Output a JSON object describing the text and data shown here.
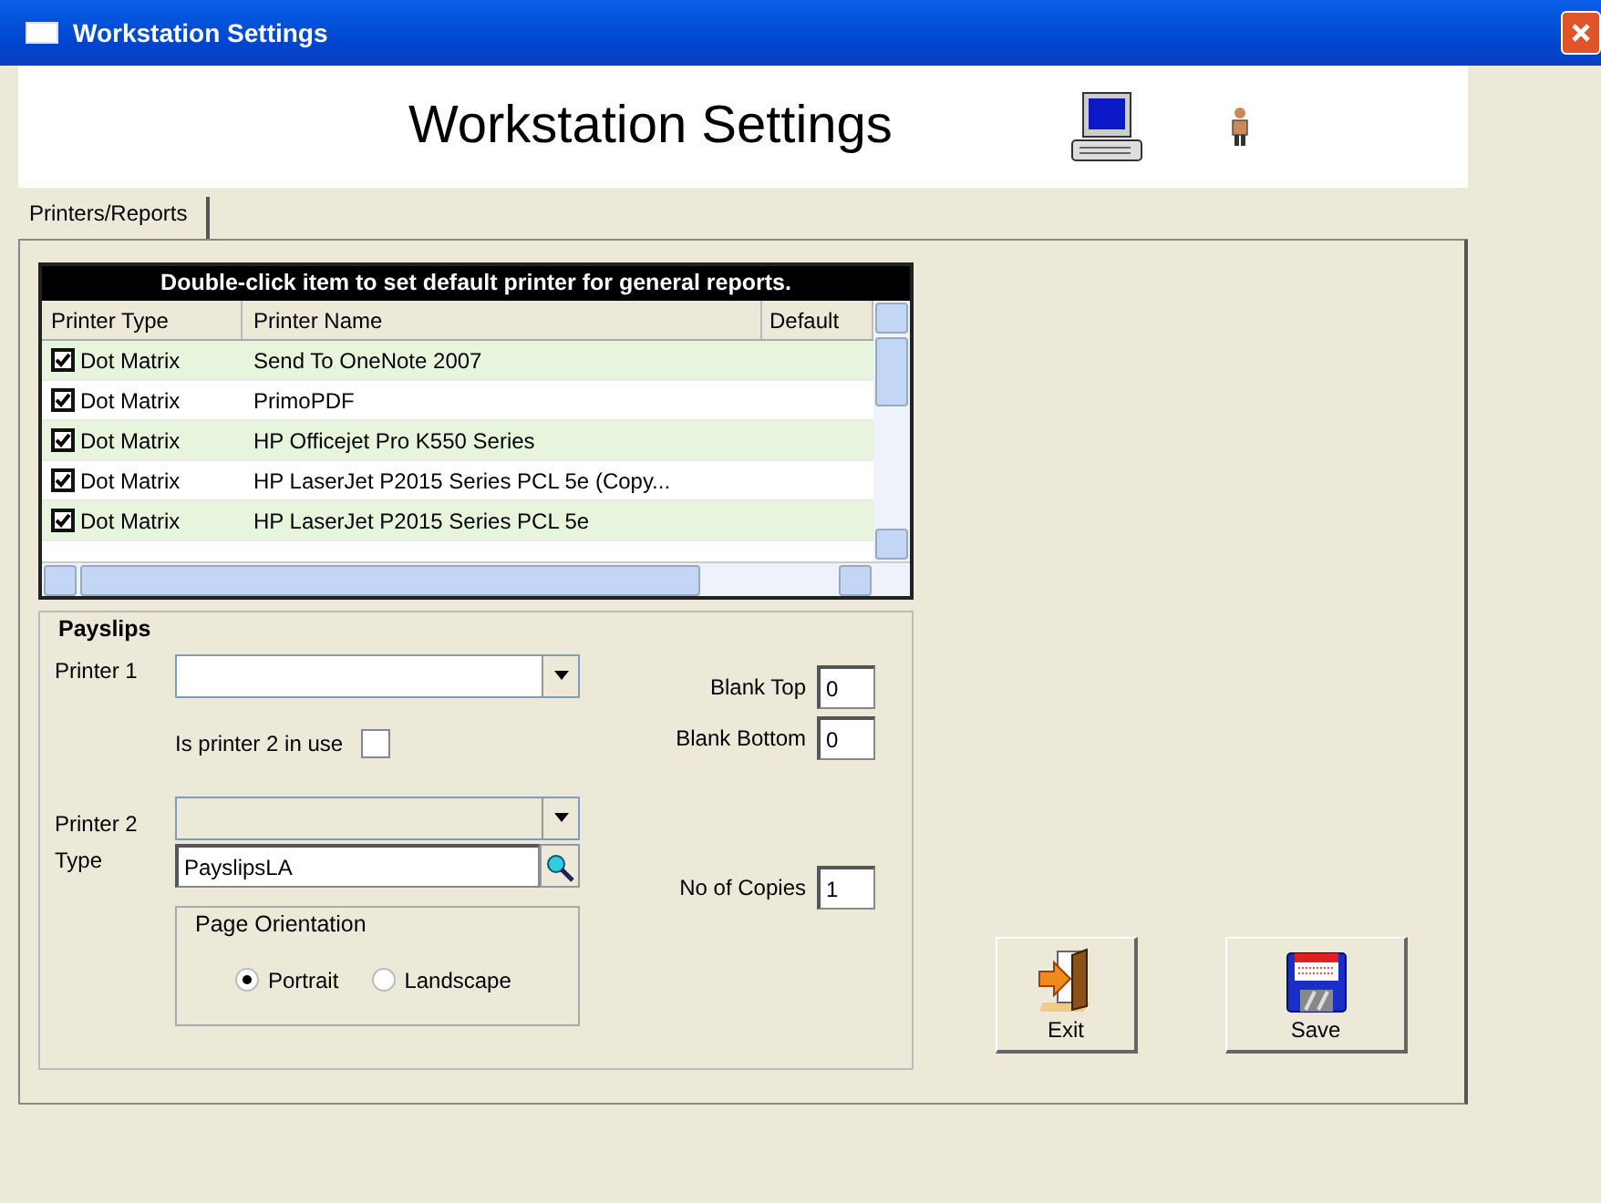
{
  "window": {
    "title": "Workstation Settings"
  },
  "header": {
    "title": "Workstation Settings"
  },
  "tabs": [
    {
      "label": "Printers/Reports",
      "selected": true
    }
  ],
  "printer_list": {
    "caption": "Double-click item to set default printer for general reports.",
    "columns": [
      "Printer Type",
      "Printer Name",
      "Default"
    ],
    "rows": [
      {
        "checked": true,
        "type": "Dot Matrix",
        "name": "Send To OneNote 2007",
        "shaded": true
      },
      {
        "checked": true,
        "type": "Dot Matrix",
        "name": "PrimoPDF",
        "shaded": false
      },
      {
        "checked": true,
        "type": "Dot Matrix",
        "name": "HP Officejet Pro K550 Series",
        "shaded": true
      },
      {
        "checked": true,
        "type": "Dot Matrix",
        "name": "HP LaserJet P2015 Series PCL 5e (Copy...",
        "shaded": false
      },
      {
        "checked": true,
        "type": "Dot Matrix",
        "name": "HP LaserJet P2015 Series PCL 5e",
        "shaded": true
      }
    ]
  },
  "payslips": {
    "title": "Payslips",
    "printer1": {
      "label": "Printer 1",
      "disabled": false
    },
    "printer2_in_use": {
      "label": "Is printer 2 in use",
      "checked": false
    },
    "printer2": {
      "label": "Printer 2",
      "disabled": true
    },
    "type": {
      "label": "Type",
      "value": "PayslipsLA"
    },
    "blank_top": {
      "label": "Blank Top",
      "value": "0"
    },
    "blank_bottom": {
      "label": "Blank Bottom",
      "value": "0"
    },
    "copies": {
      "label": "No of Copies",
      "value": "1"
    },
    "orientation": {
      "title": "Page Orientation",
      "options": [
        {
          "label": "Portrait",
          "selected": true
        },
        {
          "label": "Landscape",
          "selected": false
        }
      ]
    }
  },
  "buttons": [
    {
      "label": "Exit",
      "kind": "exit"
    },
    {
      "label": "Save",
      "kind": "save"
    }
  ]
}
